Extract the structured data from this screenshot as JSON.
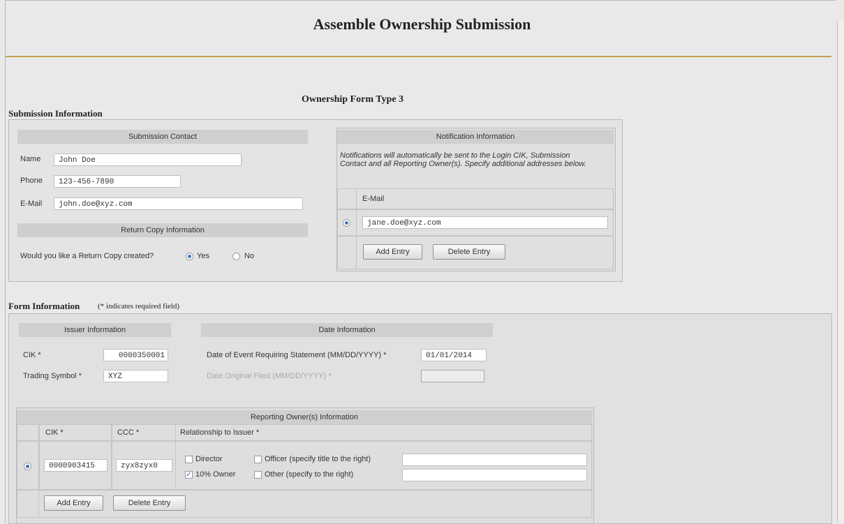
{
  "page": {
    "title": "Assemble Ownership Submission",
    "subtitle": "Ownership Form Type 3"
  },
  "submission_info": {
    "heading": "Submission Information",
    "contact": {
      "header": "Submission Contact",
      "name_label": "Name",
      "name_value": "John Doe",
      "phone_label": "Phone",
      "phone_value": "123-456-7890",
      "email_label": "E-Mail",
      "email_value": "john.doe@xyz.com"
    },
    "return_copy": {
      "header": "Return Copy Information",
      "question": "Would you like a Return Copy created?",
      "yes_label": "Yes",
      "no_label": "No",
      "selected": "Yes"
    },
    "notification": {
      "header": "Notification Information",
      "note": "Notifications will automatically be sent to the Login CIK, Submission Contact and all Reporting Owner(s). Specify additional addresses below.",
      "email_header": "E-Mail",
      "emails": [
        "jane.doe@xyz.com"
      ],
      "add_label": "Add Entry",
      "delete_label": "Delete Entry"
    }
  },
  "form_info": {
    "heading": "Form Information",
    "required_note": "(* indicates required field)",
    "issuer": {
      "header": "Issuer Information",
      "cik_label": "CIK *",
      "cik_value": "0000350001",
      "symbol_label": "Trading Symbol *",
      "symbol_value": "XYZ"
    },
    "date": {
      "header": "Date Information",
      "event_label": "Date of Event Requiring Statement (MM/DD/YYYY) *",
      "event_value": "01/01/2014",
      "original_label": "Date Original Filed (MM/DD/YYYY) *",
      "original_value": ""
    },
    "owners": {
      "header": "Reporting Owner(s) Information",
      "col_cik": "CIK *",
      "col_ccc": "CCC *",
      "col_relationship": "Relationship to Issuer *",
      "rows": [
        {
          "cik": "0000903415",
          "ccc": "zyx8zyx0",
          "director": "Director",
          "officer": "Officer (specify title to the right)",
          "ten_percent": "10% Owner",
          "other": "Other (specify to the right)"
        }
      ],
      "add_label": "Add Entry",
      "delete_label": "Delete Entry"
    }
  }
}
